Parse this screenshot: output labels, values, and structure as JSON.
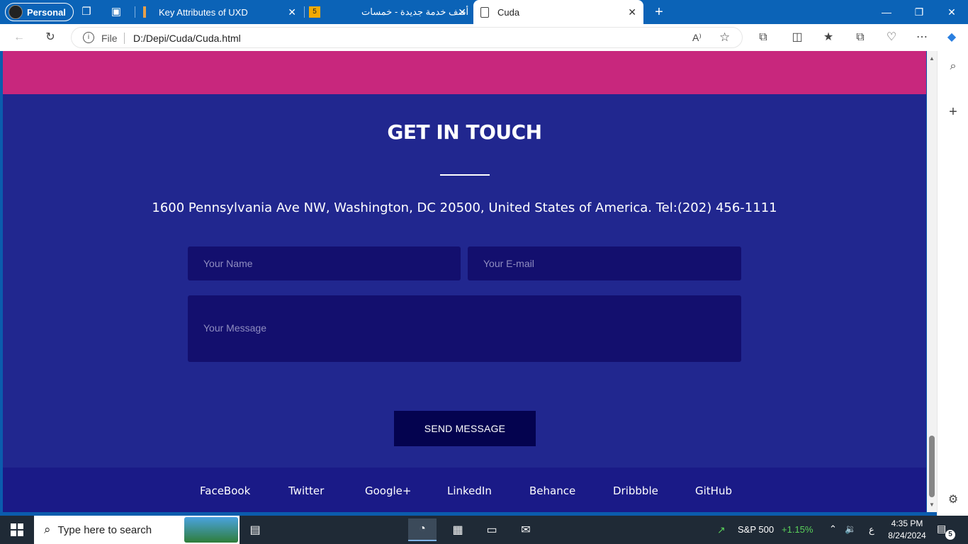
{
  "browser": {
    "profile_label": "Personal",
    "tabs": [
      {
        "title": "Key Attributes of UXD",
        "active": false
      },
      {
        "title": "أضف خدمة جديدة - خمسات",
        "active": false,
        "favicon_text": "5"
      },
      {
        "title": "Cuda",
        "active": true
      }
    ],
    "address_bar": {
      "scheme_label": "File",
      "url": "D:/Depi/Cuda/Cuda.html"
    }
  },
  "page": {
    "heading": "GET IN TOUCH",
    "address_line": "1600 Pennsylvania Ave NW, Washington, DC 20500, United States of America. Tel:(202) 456-1111",
    "form": {
      "name_placeholder": "Your Name",
      "email_placeholder": "Your E-mail",
      "message_placeholder": "Your Message",
      "send_label": "SEND MESSAGE"
    },
    "footer_links": [
      "FaceBook",
      "Twitter",
      "Google+",
      "LinkedIn",
      "Behance",
      "Dribbble",
      "GitHub"
    ],
    "colors": {
      "section_bg": "#21278f",
      "top_band": "#c8277d",
      "input_bg": "#130f6e",
      "button_bg": "#04034f",
      "footer_bg": "#1a1a87"
    }
  },
  "taskbar": {
    "search_placeholder": "Type here to search",
    "stock_label": "S&P 500",
    "stock_change": "+1.15%",
    "input_lang": "ع",
    "time": "4:35 PM",
    "date": "8/24/2024",
    "notification_count": "5"
  }
}
